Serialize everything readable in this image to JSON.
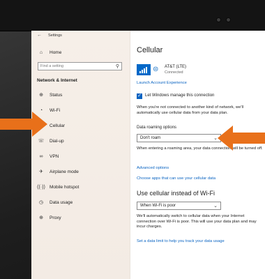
{
  "window": {
    "app_title": "Settings"
  },
  "sidebar": {
    "home_label": "Home",
    "search_placeholder": "Find a setting",
    "section_title": "Network & Internet",
    "items": [
      {
        "label": "Status",
        "icon": "globe-icon"
      },
      {
        "label": "Wi-Fi",
        "icon": "wifi-icon"
      },
      {
        "label": "Cellular",
        "icon": "cellular-icon"
      },
      {
        "label": "Dial-up",
        "icon": "dialup-icon"
      },
      {
        "label": "VPN",
        "icon": "vpn-icon"
      },
      {
        "label": "Airplane mode",
        "icon": "airplane-icon"
      },
      {
        "label": "Mobile hotspot",
        "icon": "hotspot-icon"
      },
      {
        "label": "Data usage",
        "icon": "data-usage-icon"
      },
      {
        "label": "Proxy",
        "icon": "proxy-icon"
      }
    ]
  },
  "main": {
    "title": "Cellular",
    "carrier": {
      "name": "AT&T (LTE)",
      "status": "Connected"
    },
    "launch_link": "Launch Account Experience",
    "manage_checkbox": {
      "label": "Let Windows manage this connection",
      "checked": true
    },
    "manage_description": "When you're not connected to another kind of network, we'll automatically use cellular data from your data plan.",
    "roaming": {
      "label": "Data roaming options",
      "value": "Don't roam",
      "description": "When entering a roaming area, your data connection will be turned off."
    },
    "advanced_link": "Advanced options",
    "choose_apps_link": "Choose apps that can use your cellular data",
    "use_cellular_heading": "Use cellular instead of Wi-Fi",
    "use_cellular": {
      "value": "When Wi-Fi is poor",
      "description": "We'll automatically switch to cellular data when your Internet connection over Wi-Fi is poor. This will use your data plan and may incur charges."
    },
    "data_limit_link": "Set a data limit to help you track your data usage"
  },
  "colors": {
    "accent": "#0a64c2",
    "arrow": "#e8701a"
  }
}
